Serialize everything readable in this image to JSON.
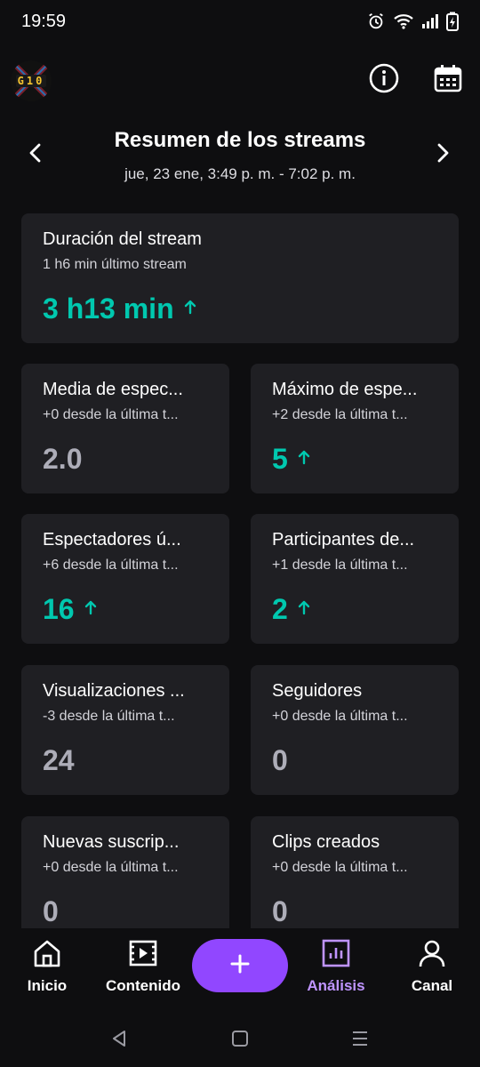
{
  "status_bar": {
    "time": "19:59",
    "icons": [
      "alarm-icon",
      "wifi-icon",
      "signal-icon",
      "battery-charging-icon"
    ]
  },
  "top_bar": {
    "avatar_text": "G10",
    "info_icon": "info-icon",
    "calendar_icon": "calendar-icon"
  },
  "header": {
    "title": "Resumen de los streams",
    "subtitle": "jue, 23 ene, 3:49 p. m. - 7:02 p. m."
  },
  "cards": [
    {
      "title": "Duración del stream",
      "sub": "1 h6 min último stream",
      "value": "3 h13 min",
      "trend": "up"
    },
    {
      "title": "Media de espec...",
      "sub": "+0 desde la última t...",
      "value": "2.0",
      "trend": "none"
    },
    {
      "title": "Máximo de espe...",
      "sub": "+2 desde la última t...",
      "value": "5",
      "trend": "up"
    },
    {
      "title": "Espectadores ú...",
      "sub": "+6 desde la última t...",
      "value": "16",
      "trend": "up"
    },
    {
      "title": "Participantes de...",
      "sub": "+1 desde la última t...",
      "value": "2",
      "trend": "up"
    },
    {
      "title": "Visualizaciones ...",
      "sub": "-3 desde la última t...",
      "value": "24",
      "trend": "none"
    },
    {
      "title": "Seguidores",
      "sub": "+0 desde la última t...",
      "value": "0",
      "trend": "none"
    },
    {
      "title": "Nuevas suscrip...",
      "sub": "+0 desde la última t...",
      "value": "0",
      "trend": "none"
    },
    {
      "title": "Clips creados",
      "sub": "+0 desde la última t...",
      "value": "0",
      "trend": "none"
    }
  ],
  "trend_up_glyph": "↑",
  "bottom_nav": {
    "items": [
      {
        "label": "Inicio",
        "icon": "home-icon",
        "active": false
      },
      {
        "label": "Contenido",
        "icon": "film-icon",
        "active": false
      },
      {
        "label": "Análisis",
        "icon": "analytics-icon",
        "active": true
      },
      {
        "label": "Canal",
        "icon": "profile-icon",
        "active": false
      }
    ],
    "create_icon": "plus-icon"
  },
  "colors": {
    "background": "#0e0e10",
    "card": "#1f1f23",
    "accent_purple": "#9147ff",
    "active_purple": "#bf94ff",
    "trend_up": "#00c8af",
    "neutral_value": "#adadb8"
  }
}
